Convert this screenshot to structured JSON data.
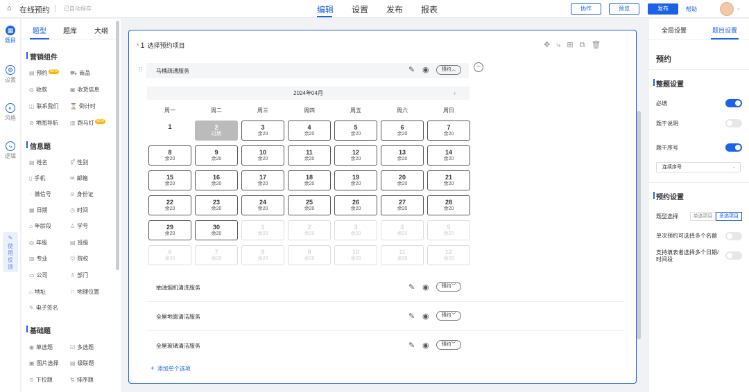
{
  "topbar": {
    "title": "在线预约",
    "autosave": "已自动保存",
    "nav": [
      "编辑",
      "设置",
      "发布",
      "报表"
    ],
    "collab": "协作",
    "preview": "预览",
    "publish": "发布",
    "help": "帮助"
  },
  "rail": {
    "items": [
      "题目",
      "设置",
      "风格",
      "逻辑"
    ],
    "feedback": "使用反馈"
  },
  "components": {
    "tabs": [
      "题型",
      "题库",
      "大纲"
    ],
    "new_badge": "NEW",
    "sections": [
      {
        "title": "营销组件",
        "items": [
          "预约",
          "商品",
          "收款",
          "收货信息",
          "联系我们",
          "倒计时",
          "地图导航",
          "跑马灯"
        ]
      },
      {
        "title": "信息题",
        "items": [
          "姓名",
          "性别",
          "手机",
          "邮箱",
          "微信号",
          "身份证",
          "日期",
          "时间",
          "年龄段",
          "学号",
          "年级",
          "班级",
          "专业",
          "院校",
          "公司",
          "部门",
          "地址",
          "地理位置",
          "电子签名"
        ]
      },
      {
        "title": "基础题",
        "items": [
          "单选题",
          "多选题",
          "图片选择",
          "级联题",
          "下拉题",
          "排序题"
        ]
      }
    ]
  },
  "question": {
    "star": "*",
    "number": "1",
    "title": "选择预约项目",
    "options": [
      "马桶疏通服务",
      "抽油烟机清洗服务",
      "全屋地面清洁服务",
      "全屋玻璃清洁服务"
    ],
    "pill_open": "预约",
    "pill_closed": "预约",
    "add_option": "添加单个选项"
  },
  "calendar": {
    "month": "2024年04月",
    "weekdays": [
      "周一",
      "周二",
      "周三",
      "周四",
      "周五",
      "周六",
      "周日"
    ],
    "remain": "余20",
    "past_label": "过期",
    "weeks": [
      [
        "1",
        "2",
        "3",
        "4",
        "5",
        "6",
        "7"
      ],
      [
        "8",
        "9",
        "10",
        "11",
        "12",
        "13",
        "14"
      ],
      [
        "15",
        "16",
        "17",
        "18",
        "19",
        "20",
        "21"
      ],
      [
        "22",
        "23",
        "24",
        "25",
        "26",
        "27",
        "28"
      ],
      [
        "29",
        "30",
        "1",
        "2",
        "3",
        "4",
        "5"
      ],
      [
        "6",
        "7",
        "8",
        "9",
        "10",
        "11",
        "12"
      ]
    ]
  },
  "right_panel": {
    "tabs": [
      "全局设置",
      "题目设置"
    ],
    "heading": "预约",
    "basic_title": "整题设置",
    "required": "必填",
    "desc": "题干说明",
    "seq": "题干序号",
    "seq_select": "连续序号",
    "booking_title": "预约设置",
    "type_label": "题型选择",
    "type_single": "单选项目",
    "type_multi": "多选项目",
    "multi_quota": "单次预约可选择多个名额",
    "multi_date": "支持填表者选择多个日期/时间段",
    "toggles": {
      "required": true,
      "desc": false,
      "seq": true,
      "multi_quota": false,
      "multi_date": false
    }
  },
  "colors": {
    "accent": "#1a62e8",
    "badge": "#ffb400"
  }
}
